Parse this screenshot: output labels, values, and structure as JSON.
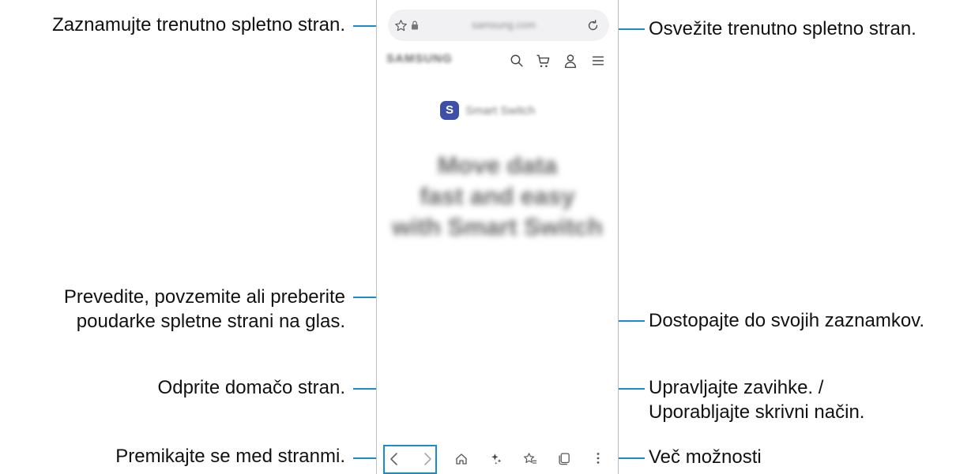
{
  "callouts": {
    "bookmark": "Zaznamujte trenutno spletno stran.",
    "refresh": "Osvežite trenutno spletno stran.",
    "assist_line1": "Prevedite, povzemite ali preberite",
    "assist_line2": "poudarke spletne strani na glas.",
    "bookmarks": "Dostopajte do svojih zaznamkov.",
    "home": "Odprite domačo stran.",
    "tabs_line1": "Upravljajte zavihke. /",
    "tabs_line2": "Uporabljajte skrivni način.",
    "navigate": "Premikajte se med stranmi.",
    "more": "Več možnosti"
  },
  "browser": {
    "url_placeholder": "samsung.com",
    "site_logo": "SAMSUNG",
    "card_letter": "S",
    "card_title": "Smart Switch",
    "hero_line1": "Move data",
    "hero_line2": "fast and easy",
    "hero_line3": "with Smart Switch"
  },
  "colors": {
    "accent": "#1a8bd0",
    "smart_switch": "#3e4fa8"
  },
  "icons": [
    "star-icon",
    "lock-icon",
    "refresh-icon",
    "search-icon",
    "cart-icon",
    "user-icon",
    "menu-icon",
    "back-icon",
    "forward-icon",
    "home-icon",
    "assistant-icon",
    "bookmarks-icon",
    "tabs-icon",
    "more-icon"
  ]
}
